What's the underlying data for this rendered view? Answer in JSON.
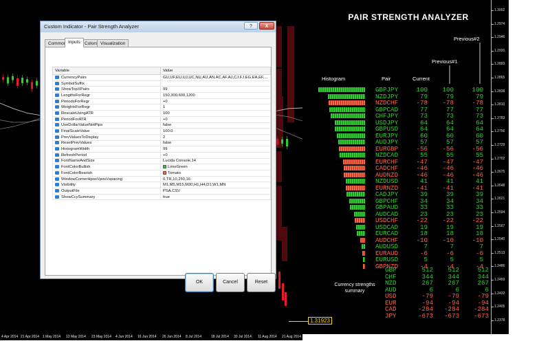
{
  "indicator_title": "PAIR STRENGTH ANALYZER",
  "columns": {
    "histogram": "Histogram",
    "pair": "Pair",
    "current": "Current",
    "previous1": "Previous#1",
    "previous2": "Previous#2"
  },
  "colors": {
    "bullish": "#32cd32",
    "bearish": "#ff6347",
    "chart_bg": "#000000",
    "last_price": "#ffd800"
  },
  "pairs": [
    {
      "pair": "GBPJPY",
      "current": 100,
      "prev1": 100,
      "prev2": 100
    },
    {
      "pair": "NZDJPY",
      "current": 79,
      "prev1": 79,
      "prev2": 79
    },
    {
      "pair": "NZDCHF",
      "current": -78,
      "prev1": -78,
      "prev2": -78
    },
    {
      "pair": "GBPCAD",
      "current": 77,
      "prev1": 77,
      "prev2": 77
    },
    {
      "pair": "CHFJPY",
      "current": 73,
      "prev1": 73,
      "prev2": 73
    },
    {
      "pair": "USDJPY",
      "current": 64,
      "prev1": 64,
      "prev2": 64
    },
    {
      "pair": "GBPUSD",
      "current": 64,
      "prev1": 64,
      "prev2": 64
    },
    {
      "pair": "EURJPY",
      "current": 60,
      "prev1": 60,
      "prev2": 60
    },
    {
      "pair": "AUDJPY",
      "current": 57,
      "prev1": 57,
      "prev2": 57
    },
    {
      "pair": "EURGBP",
      "current": -56,
      "prev1": -56,
      "prev2": -56
    },
    {
      "pair": "NZDCAD",
      "current": 55,
      "prev1": 55,
      "prev2": 55
    },
    {
      "pair": "EURCHF",
      "current": -47,
      "prev1": -47,
      "prev2": -47
    },
    {
      "pair": "CADCHF",
      "current": -46,
      "prev1": -46,
      "prev2": -46
    },
    {
      "pair": "AUDNZD",
      "current": -46,
      "prev1": -46,
      "prev2": -46
    },
    {
      "pair": "NZDUSD",
      "current": 41,
      "prev1": 41,
      "prev2": 41
    },
    {
      "pair": "EURNZD",
      "current": -41,
      "prev1": -41,
      "prev2": -41
    },
    {
      "pair": "CADJPY",
      "current": 39,
      "prev1": 39,
      "prev2": 39
    },
    {
      "pair": "GBPCHF",
      "current": 34,
      "prev1": 34,
      "prev2": 34
    },
    {
      "pair": "GBPAUD",
      "current": 33,
      "prev1": 33,
      "prev2": 33
    },
    {
      "pair": "AUDCAD",
      "current": 23,
      "prev1": 23,
      "prev2": 23
    },
    {
      "pair": "USDCHF",
      "current": -22,
      "prev1": -22,
      "prev2": -22
    },
    {
      "pair": "USDCAD",
      "current": 19,
      "prev1": 19,
      "prev2": 19
    },
    {
      "pair": "EURCAD",
      "current": 18,
      "prev1": 18,
      "prev2": 18
    },
    {
      "pair": "AUDCHF",
      "current": -10,
      "prev1": -10,
      "prev2": -10
    },
    {
      "pair": "AUDUSD",
      "current": 7,
      "prev1": 7,
      "prev2": 7
    },
    {
      "pair": "EURAUD",
      "current": -6,
      "prev1": -6,
      "prev2": -6
    },
    {
      "pair": "EURUSD",
      "current": 5,
      "prev1": 5,
      "prev2": 5
    },
    {
      "pair": "GBPNZD",
      "current": -4,
      "prev1": -4,
      "prev2": -4
    }
  ],
  "summary_label": "Currency strengths summary",
  "currencies": [
    {
      "ccy": "GBP",
      "current": 512,
      "prev1": 512,
      "prev2": 512
    },
    {
      "ccy": "CHF",
      "current": 344,
      "prev1": 344,
      "prev2": 344
    },
    {
      "ccy": "NZD",
      "current": 267,
      "prev1": 267,
      "prev2": 267
    },
    {
      "ccy": "AUD",
      "current": 6,
      "prev1": 6,
      "prev2": 6
    },
    {
      "ccy": "USD",
      "current": -79,
      "prev1": -79,
      "prev2": -79
    },
    {
      "ccy": "EUR",
      "current": -94,
      "prev1": -94,
      "prev2": -94
    },
    {
      "ccy": "CAD",
      "current": -284,
      "prev1": -284,
      "prev2": -284
    },
    {
      "ccy": "JPY",
      "current": -673,
      "prev1": -673,
      "prev2": -673
    }
  ],
  "price_scale": [
    "1.29920",
    "1.29345",
    "1.28770",
    "1.28195",
    "1.27620",
    "1.27045",
    "1.26470",
    "1.25895",
    "1.25320",
    "1.24745",
    "1.24170",
    "1.23595",
    "1.23020",
    "1.22445",
    "1.21870",
    "1.21295",
    "1.20720",
    "1.20145",
    "1.19570",
    "1.18995",
    "1.18420",
    "1.17845",
    "1.17270",
    "1.16695"
  ],
  "price_scale_short": [
    "1.3002",
    "1.2974",
    "1.2946",
    "1.2920",
    "1.2893",
    "1.2865",
    "1.2838",
    "1.2810",
    "1.2783",
    "1.2756",
    "1.2729",
    "1.2702",
    "1.2675",
    "1.2648",
    "1.2621",
    "1.2594",
    "1.2567",
    "1.2540",
    "1.2513",
    "1.2486",
    "1.2459",
    "1.2432",
    "1.2405",
    "1.2378"
  ],
  "time_scale": [
    "4 Apr 2014",
    "21 Apr 2014",
    "1 May 2014",
    "13 May 2014",
    "23 May 2014",
    "4 Jun 2014",
    "16 Jun 2014",
    "26 Jun 2014",
    "8 Jul 2014",
    "18 Jul 2014",
    "30 Jul 2014",
    "11 Aug 2014",
    "21 Aug 2014"
  ],
  "last_price": "1.31923",
  "dialog": {
    "title": "Custom Indicator - Pair Strength Analyzer",
    "help_label": "?",
    "close_label": "X",
    "tabs": [
      "Common",
      "Inputs",
      "Colors",
      "Visualization"
    ],
    "active_tab": "Inputs",
    "header_variable": "Variable",
    "header_value": "Value",
    "params": [
      {
        "name": "CurrencyPairs",
        "value": "GU,UF,EU,UJ,UC,NU,AU,AN,AC,AF,AJ,CJ,FJ,EG,EA,EF,..."
      },
      {
        "name": "SymbolSuffix",
        "value": ""
      },
      {
        "name": "ShowTopXPairs",
        "value": "99"
      },
      {
        "name": "LengthsForRegr",
        "value": "150,300,600,1200"
      },
      {
        "name": "PeriodsForRegr",
        "value": "+0"
      },
      {
        "name": "WeightsForRegr",
        "value": "1"
      },
      {
        "name": "RescaleUsingATR",
        "value": "100"
      },
      {
        "name": "PeriodForATR",
        "value": "+0"
      },
      {
        "name": "UseDollarValueNotPips",
        "value": "false"
      },
      {
        "name": "FinalScaleValue",
        "value": "100.0"
      },
      {
        "name": "PrevValuesToDisplay",
        "value": "2"
      },
      {
        "name": "ResetPrevValues",
        "value": "false"
      },
      {
        "name": "HistogramWidth",
        "value": "99"
      },
      {
        "name": "RefreshPeriod",
        "value": "+0"
      },
      {
        "name": "FontNameAndSize",
        "value": "Lucida Console,14"
      },
      {
        "name": "FontColorBullish",
        "value": "LimeGreen",
        "swatch": "#32cd32"
      },
      {
        "name": "FontColorBearish",
        "value": "Tomato",
        "swatch": "#ff6347"
      },
      {
        "name": "WindowCornerHposVposVspacing",
        "value": "0,TR,10,250,16"
      },
      {
        "name": "Visibility",
        "value": "M1,M5,M15,M30,H1,H4,D1,W1,MN"
      },
      {
        "name": "OutputFile",
        "value": "PSA.CSV"
      },
      {
        "name": "ShowCcySummary",
        "value": "true"
      }
    ],
    "ok_label": "OK",
    "cancel_label": "Cancel",
    "reset_label": "Reset"
  }
}
